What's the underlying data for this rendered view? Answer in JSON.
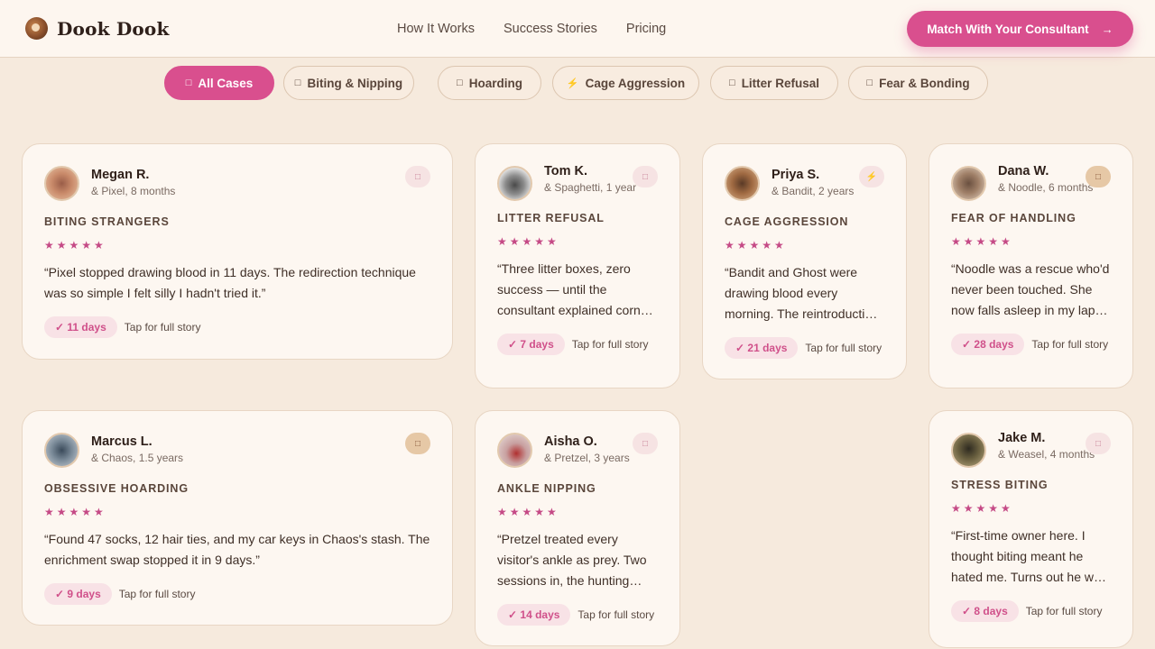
{
  "brand": {
    "name": "Dook Dook"
  },
  "nav": [
    "How It Works",
    "Success Stories",
    "Pricing"
  ],
  "cta": {
    "label": "Match With Your Consultant",
    "arrow": "→"
  },
  "filters": [
    {
      "icon": "□",
      "label": "All Cases",
      "active": true
    },
    {
      "icon": "□",
      "label": "Biting & Nipping"
    },
    {
      "icon": "□",
      "label": "Hoarding"
    },
    {
      "icon": "⚡",
      "label": "Cage Aggression"
    },
    {
      "icon": "□",
      "label": "Litter Refusal"
    },
    {
      "icon": "□",
      "label": "Fear & Bonding"
    }
  ],
  "cards": [
    {
      "name": "Megan R.",
      "pet": "& Pixel, 8 months",
      "issue": "BITING STRANGERS",
      "stars": "★★★★★",
      "quote": "“Pixel stopped drawing blood in 11 days. The redirection technique was so simple I felt silly I hadn't tried it.”",
      "days": "✓ 11 days",
      "tap": "Tap for full story",
      "badge": "□"
    },
    {
      "name": "Tom K.",
      "pet": "& Spaghetti, 1 year",
      "issue": "LITTER REFUSAL",
      "stars": "★★★★★",
      "quote": "“Three litter boxes, zero success — until the consultant explained corner placement and substrate depth.”",
      "days": "✓ 7 days",
      "tap": "Tap for full story",
      "badge": "□"
    },
    {
      "name": "Priya S.",
      "pet": "& Bandit, 2 years",
      "issue": "CAGE AGGRESSION",
      "stars": "★★★★★",
      "quote": "“Bandit and Ghost were drawing blood every morning. The reintroduction plan changed everything.”",
      "days": "✓ 21 days",
      "tap": "Tap for full story",
      "badge": "⚡"
    },
    {
      "name": "Dana W.",
      "pet": "& Noodle, 6 months",
      "issue": "FEAR OF HANDLING",
      "stars": "★★★★★",
      "quote": "“Noodle was a rescue who'd never been touched. She now falls asleep in my lap every evening.”",
      "days": "✓ 28 days",
      "tap": "Tap for full story",
      "badge": "□"
    },
    {
      "name": "Marcus L.",
      "pet": "& Chaos, 1.5 years",
      "issue": "OBSESSIVE HOARDING",
      "stars": "★★★★★",
      "quote": "“Found 47 socks, 12 hair ties, and my car keys in Chaos's stash. The enrichment swap stopped it in 9 days.”",
      "days": "✓ 9 days",
      "tap": "Tap for full story",
      "badge": "□"
    },
    {
      "name": "Aisha O.",
      "pet": "& Pretzel, 3 years",
      "issue": "ANKLE NIPPING",
      "stars": "★★★★★",
      "quote": "“Pretzel treated every visitor's ankle as prey. Two sessions in, the hunting games replaced the biting.”",
      "days": "✓ 14 days",
      "tap": "Tap for full story",
      "badge": "□"
    },
    {
      "name": "Jake M.",
      "pet": "& Weasel, 4 months",
      "issue": "STRESS BITING",
      "stars": "★★★★★",
      "quote": "“First-time owner here. I thought biting meant he hated me. Turns out he was just scared.”",
      "days": "✓ 8 days",
      "tap": "Tap for full story",
      "badge": "□"
    }
  ]
}
